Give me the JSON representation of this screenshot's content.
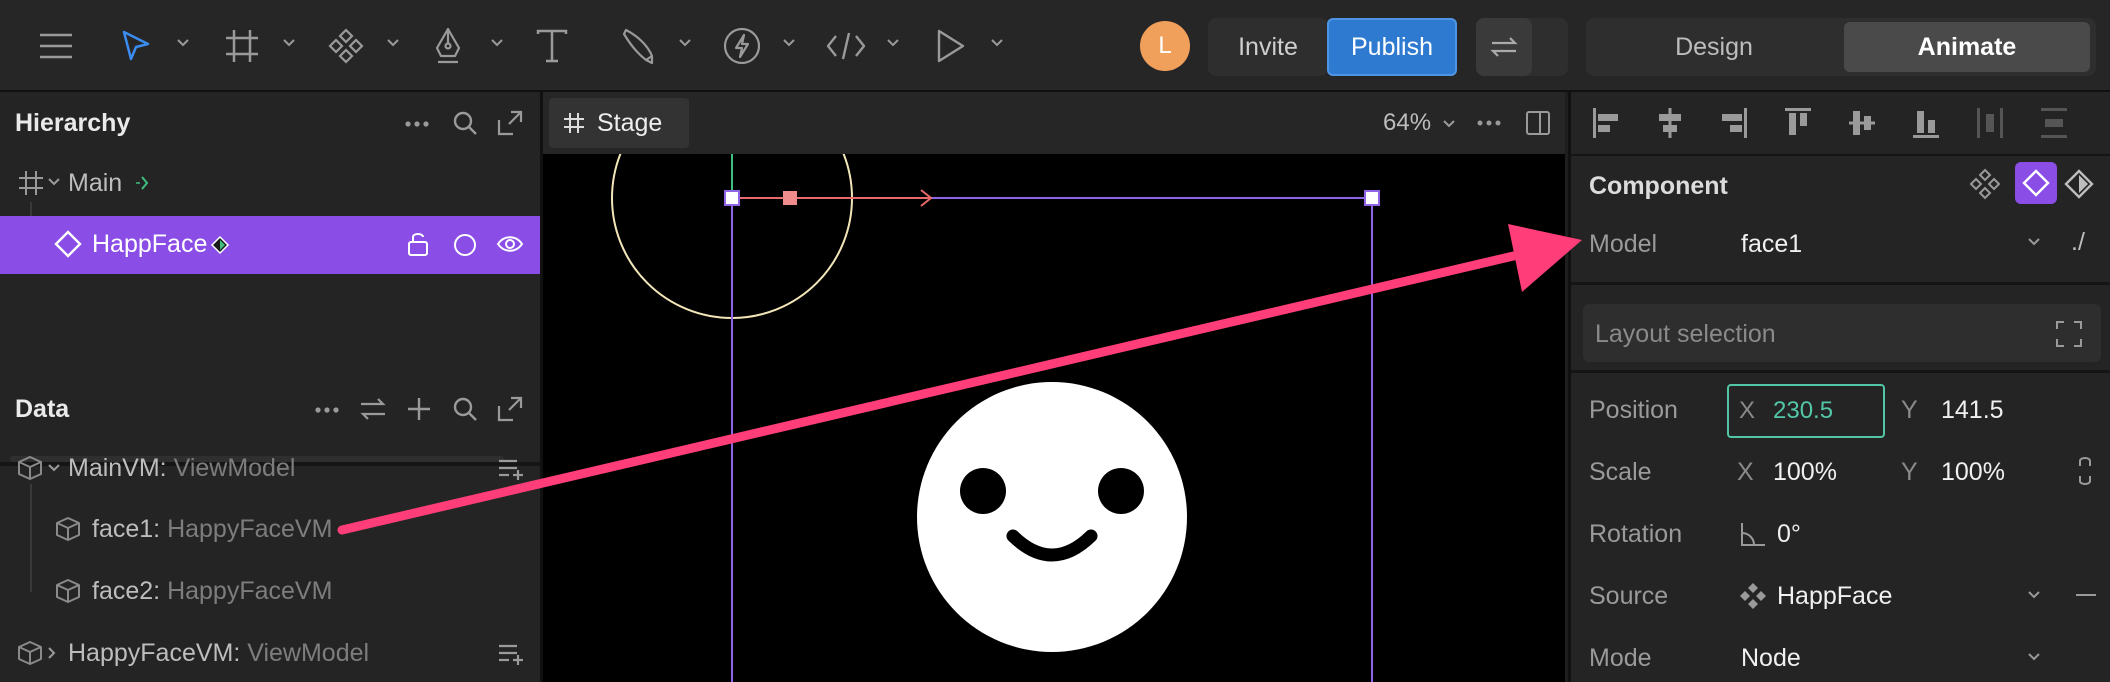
{
  "toolbar": {
    "avatar_initial": "L",
    "invite_label": "Invite",
    "publish_label": "Publish",
    "design_tab": "Design",
    "animate_tab": "Animate",
    "tools": [
      "menu-icon",
      "select-tool-icon",
      "frame-tool-icon",
      "component-tool-icon",
      "pen-tool-icon",
      "text-tool-icon",
      "brush-tool-icon",
      "bolt-tool-icon",
      "code-tool-icon",
      "play-tool-icon"
    ]
  },
  "hierarchy": {
    "title": "Hierarchy",
    "main_label": "Main",
    "selected_label": "HappFace"
  },
  "data_panel": {
    "title": "Data",
    "items": [
      {
        "name": "MainVM:",
        "type": "ViewModel"
      },
      {
        "name": "face1:",
        "type": "HappyFaceVM"
      },
      {
        "name": "face2:",
        "type": "HappyFaceVM"
      },
      {
        "name": "HappyFaceVM:",
        "type": "ViewModel"
      }
    ]
  },
  "stage": {
    "tab_label": "Stage",
    "zoom": "64%"
  },
  "inspector": {
    "section_title": "Component",
    "model_label": "Model",
    "model_value": "face1",
    "model_link": "./",
    "layout_selection": "Layout selection",
    "position_label": "Position",
    "pos_x_label": "X",
    "pos_x": "230.5",
    "pos_y_label": "Y",
    "pos_y": "141.5",
    "scale_label": "Scale",
    "scale_x_label": "X",
    "scale_x": "100%",
    "scale_y_label": "Y",
    "scale_y": "100%",
    "rotation_label": "Rotation",
    "rotation": "0°",
    "source_label": "Source",
    "source": "HappFace",
    "mode_label": "Mode",
    "mode": "Node"
  },
  "colors": {
    "accent_purple": "#8a4de6",
    "publish_blue": "#2f7ad1",
    "annotation_arrow": "#ff3d78",
    "x_field_border": "#53c6a8"
  }
}
